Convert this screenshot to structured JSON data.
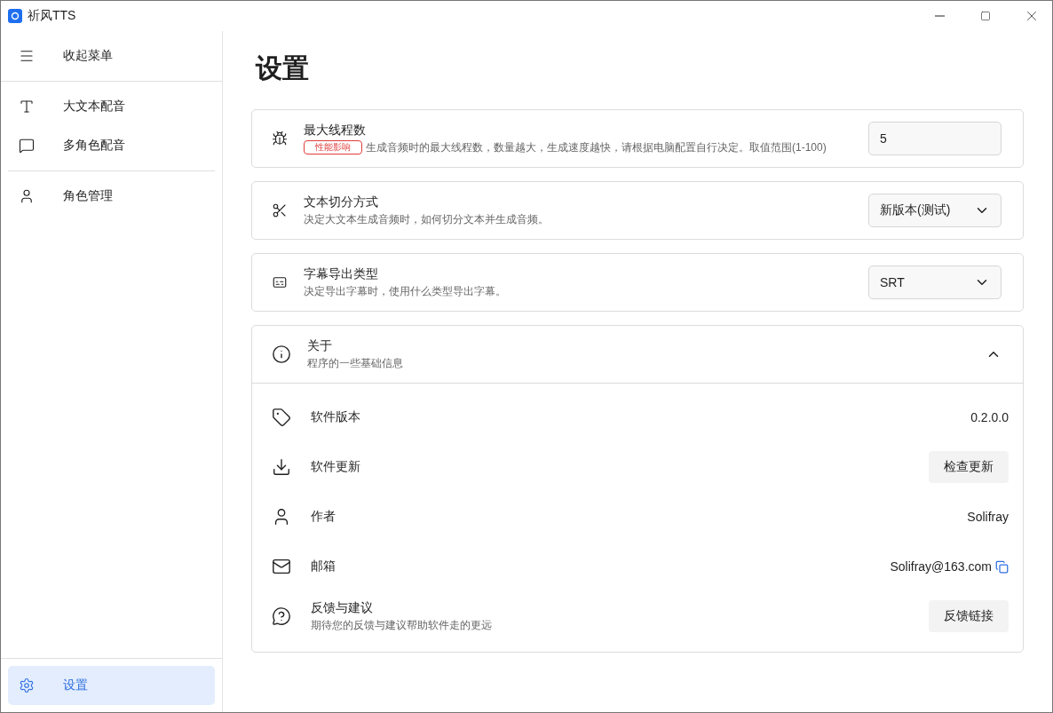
{
  "window": {
    "title": "祈风TTS"
  },
  "sidebar": {
    "toggle": {
      "label": "收起菜单"
    },
    "groups": [
      [
        {
          "label": "大文本配音",
          "selected": false
        },
        {
          "label": "多角色配音",
          "selected": false
        }
      ],
      [
        {
          "label": "角色管理",
          "selected": false
        }
      ]
    ],
    "bottom": {
      "label": "设置",
      "selected": true
    }
  },
  "page": {
    "title": "设置",
    "settings": [
      {
        "kind": "input",
        "title": "最大线程数",
        "badge": "性能影响",
        "description": "生成音频时的最大线程数，数量越大，生成速度越快，请根据电脑配置自行决定。取值范围(1-100)",
        "value": "5"
      },
      {
        "kind": "select",
        "title": "文本切分方式",
        "description": "决定大文本生成音频时，如何切分文本并生成音频。",
        "value": "新版本(测试)"
      },
      {
        "kind": "select",
        "title": "字幕导出类型",
        "description": "决定导出字幕时，使用什么类型导出字幕。",
        "value": "SRT"
      }
    ],
    "about": {
      "title": "关于",
      "description": "程序的一些基础信息",
      "expanded": true,
      "rows": [
        {
          "kind": "text",
          "label": "软件版本",
          "value": "0.2.0.0"
        },
        {
          "kind": "button",
          "label": "软件更新",
          "value": "检查更新"
        },
        {
          "kind": "text",
          "label": "作者",
          "value": "Solifray"
        },
        {
          "kind": "copy",
          "label": "邮箱",
          "value": "Solifray@163.com"
        },
        {
          "kind": "button",
          "label": "反馈与建议",
          "description": "期待您的反馈与建议帮助软件走的更远",
          "value": "反馈链接"
        }
      ]
    }
  }
}
